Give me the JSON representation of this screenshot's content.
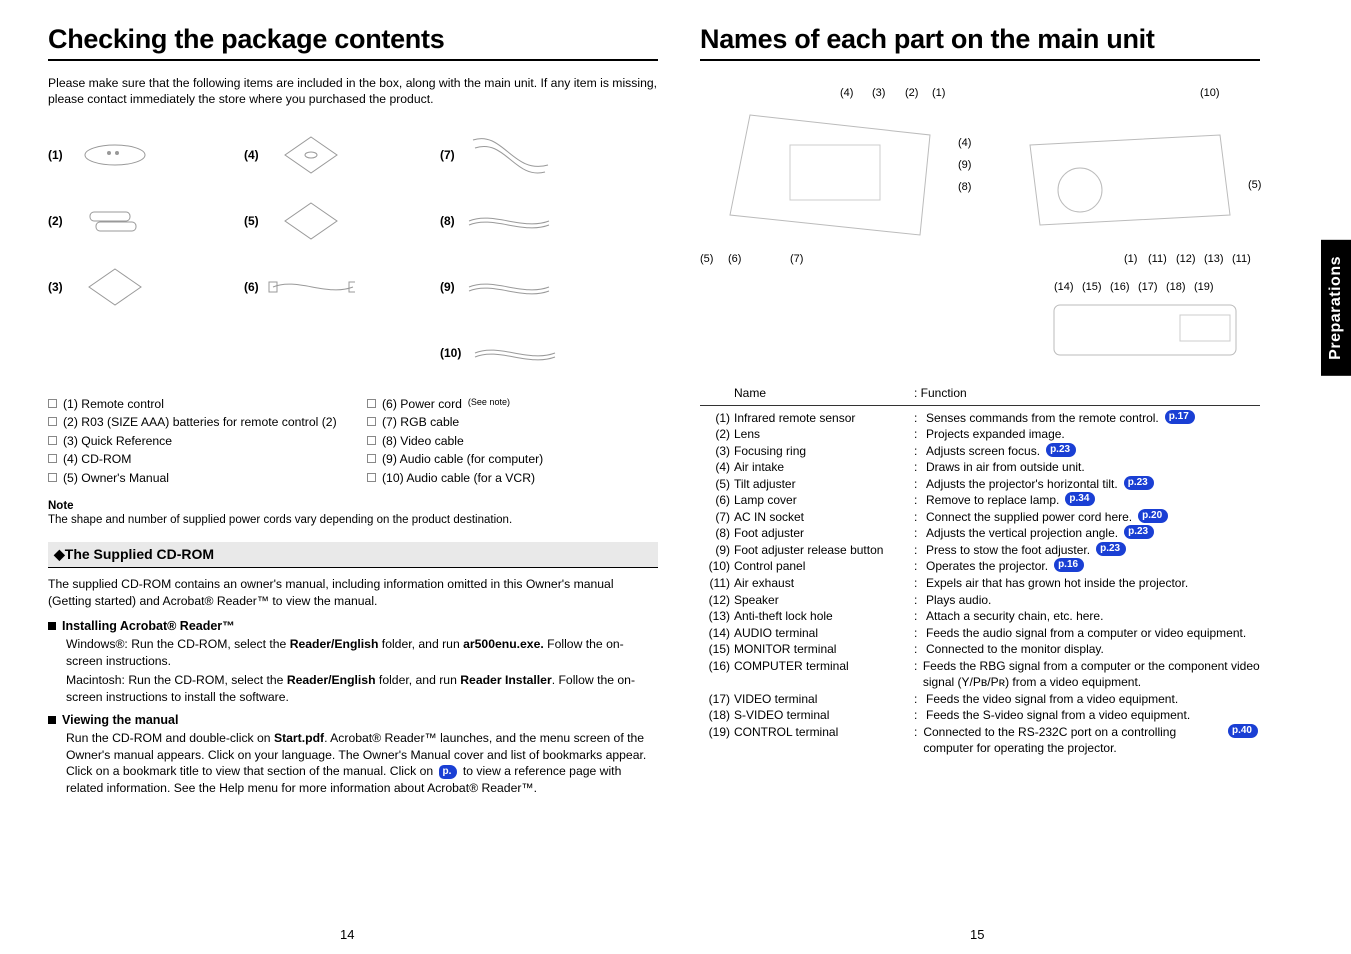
{
  "left": {
    "title": "Checking the package contents",
    "intro": "Please make sure that the following items are included in the box, along with the main unit. If any item is missing, please contact immediately the store where you purchased the product.",
    "items_numbers": [
      "(1)",
      "(2)",
      "(3)",
      "(4)",
      "(5)",
      "(6)",
      "(7)",
      "(8)",
      "(9)",
      "(10)"
    ],
    "checklist_left": [
      "(1)  Remote control",
      "(2)  R03 (SIZE AAA) batteries for remote control (2)",
      "(3)  Quick Reference",
      "(4)  CD-ROM",
      "(5)  Owner's Manual"
    ],
    "checklist_right": [
      {
        "text": "(6)  Power cord ",
        "note": "(See note)"
      },
      {
        "text": "(7)  RGB cable"
      },
      {
        "text": "(8)  Video cable"
      },
      {
        "text": "(9)  Audio cable (for computer)"
      },
      {
        "text": "(10) Audio cable (for a VCR)"
      }
    ],
    "note_h": "Note",
    "note_t": "The shape and number of supplied power cords vary depending on the product destination.",
    "cd_head": "◆The Supplied CD-ROM",
    "cd_intro": "The supplied CD-ROM contains an owner's manual, including information omitted in this Owner's manual (Getting started) and Acrobat® Reader™ to view the manual.",
    "install_h": "Installing Acrobat® Reader™",
    "install_p1_a": "Windows®: Run the CD-ROM, select the ",
    "install_p1_b": "Reader/English",
    "install_p1_c": " folder, and run ",
    "install_p1_d": "ar500enu.exe.",
    "install_p1_e": " Follow the on-screen instructions.",
    "install_p2_a": "Macintosh: Run the CD-ROM, select the ",
    "install_p2_b": "Reader/English",
    "install_p2_c": " folder, and run ",
    "install_p2_d": "Reader Installer",
    "install_p2_e": ". Follow the on-screen instructions to install the software.",
    "view_h": "Viewing the manual",
    "view_p_a": "Run the CD-ROM and double-click on ",
    "view_p_b": "Start.pdf",
    "view_p_c": ". Acrobat® Reader™ launches, and the menu screen of the Owner's manual appears. Click on your language. The Owner's Manual cover and list of bookmarks appear. Click on a bookmark title to view that section of the manual. Click on ",
    "view_p_d": "p.",
    "view_p_e": " to view a reference page with related information. See the Help menu for more information about Acrobat® Reader™.",
    "page_num": "14"
  },
  "right": {
    "title": "Names of each part on the main unit",
    "diag_callouts_top": [
      "(4)",
      "(3)",
      "(2)",
      "(1)",
      "(4)",
      "(9)",
      "(8)",
      "(5)",
      "(6)",
      "(7)",
      "(10)",
      "(5)",
      "(1)",
      "(11)",
      "(12)",
      "(13)",
      "(11)"
    ],
    "diag_callouts_bot": [
      "(14)",
      "(15)",
      "(16)",
      "(17)",
      "(18)",
      "(19)"
    ],
    "table_head": {
      "name": "Name",
      "func": ": Function"
    },
    "parts": [
      {
        "n": "(1)",
        "name": "Infrared remote sensor",
        "func": "Senses commands from the remote control.",
        "ref": "p.17"
      },
      {
        "n": "(2)",
        "name": "Lens",
        "func": "Projects expanded image."
      },
      {
        "n": "(3)",
        "name": "Focusing ring",
        "func": "Adjusts screen focus.",
        "ref": "p.23"
      },
      {
        "n": "(4)",
        "name": "Air intake",
        "func": "Draws in air from outside unit."
      },
      {
        "n": "(5)",
        "name": "Tilt adjuster",
        "func": "Adjusts the projector's horizontal tilt.",
        "ref": "p.23"
      },
      {
        "n": "(6)",
        "name": "Lamp cover",
        "func": "Remove to replace lamp.",
        "ref": "p.34"
      },
      {
        "n": "(7)",
        "name": "AC IN socket",
        "func": "Connect the supplied power cord here.",
        "ref": "p.20"
      },
      {
        "n": "(8)",
        "name": "Foot adjuster",
        "func": "Adjusts the vertical projection angle.",
        "ref": "p.23"
      },
      {
        "n": "(9)",
        "name": "Foot adjuster release button",
        "func": "Press to stow the foot adjuster.",
        "ref": "p.23"
      },
      {
        "n": "(10)",
        "name": "Control panel",
        "func": "Operates the projector.",
        "ref": "p.16"
      },
      {
        "n": "(11)",
        "name": "Air exhaust",
        "func": "Expels air that has grown hot inside the projector."
      },
      {
        "n": "(12)",
        "name": "Speaker",
        "func": "Plays audio."
      },
      {
        "n": "(13)",
        "name": "Anti-theft lock hole",
        "func": "Attach a security chain, etc. here."
      },
      {
        "n": "(14)",
        "name": "AUDIO terminal",
        "func": "Feeds the audio signal from a computer or video equipment."
      },
      {
        "n": "(15)",
        "name": "MONITOR terminal",
        "func": "Connected to the monitor display."
      },
      {
        "n": "(16)",
        "name": "COMPUTER terminal",
        "func": "Feeds the RBG signal from a computer or the component video signal (Y/Pʙ/Pʀ) from a video equipment."
      },
      {
        "n": "(17)",
        "name": "VIDEO terminal",
        "func": "Feeds the video signal from a video equipment."
      },
      {
        "n": "(18)",
        "name": "S-VIDEO terminal",
        "func": "Feeds the S-video signal from a video equipment."
      },
      {
        "n": "(19)",
        "name": "CONTROL terminal",
        "func": "Connected to the RS-232C port on a controlling computer for operating the projector.",
        "ref": "p.40"
      }
    ],
    "tab": "Preparations",
    "page_num": "15"
  }
}
